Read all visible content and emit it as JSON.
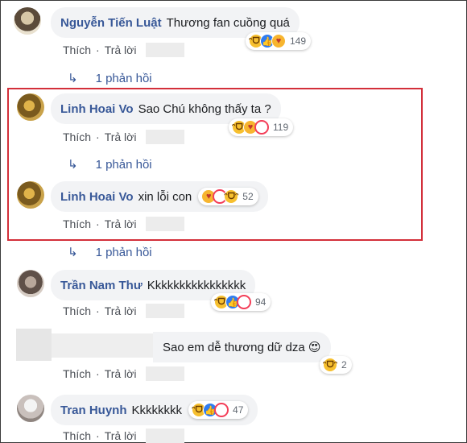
{
  "comments": [
    {
      "author": "Nguyễn Tiến Luật",
      "text": "Thương fan cuồng quá",
      "reaction_count": "149",
      "reactions": [
        "haha-icon",
        "like-icon",
        "hug-icon"
      ]
    },
    {
      "author": "Linh Hoai Vo",
      "text": "Sao Chú không thấy ta ?",
      "reaction_count": "119",
      "reactions": [
        "haha-icon",
        "hug-icon",
        "love-icon"
      ]
    },
    {
      "author": "Linh Hoai Vo",
      "text": "xin lỗi con",
      "reaction_count": "52",
      "reactions": [
        "hug-icon",
        "love-icon",
        "haha-icon"
      ]
    },
    {
      "author": "Trần Nam Thư",
      "text": "Kkkkkkkkkkkkkkkk",
      "reaction_count": "94",
      "reactions": [
        "haha-icon",
        "like-icon",
        "love-icon"
      ]
    },
    {
      "author": "",
      "text": "Sao em dễ thương dữ dza 😍",
      "reaction_count": "2",
      "reactions": [
        "haha-icon"
      ]
    },
    {
      "author": "Tran Huynh",
      "text": "Kkkkkkkk",
      "reaction_count": "47",
      "reactions": [
        "haha-icon",
        "like-icon",
        "love-icon"
      ]
    }
  ],
  "actions": {
    "like": "Thích",
    "reply": "Trả lời",
    "separator": "·"
  },
  "replies_link": "1 phản hồi",
  "colors": {
    "highlight": "#d32f3a",
    "author": "#385898",
    "bubble": "#f2f3f5"
  }
}
